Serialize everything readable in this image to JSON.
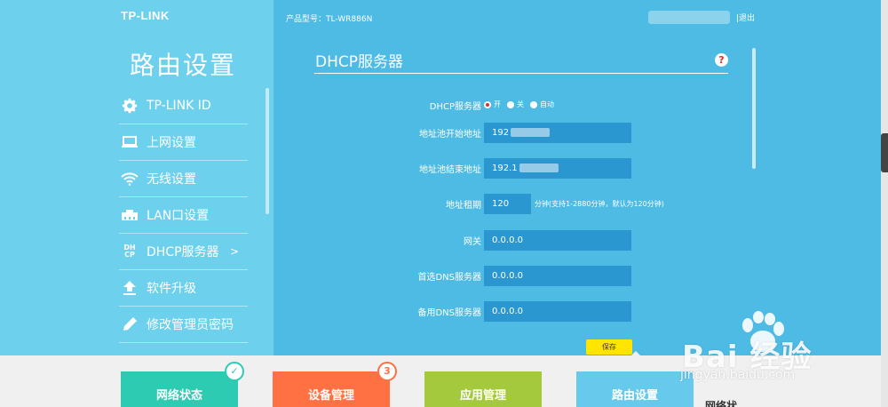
{
  "brand": {
    "logo": "TP-LINK"
  },
  "header": {
    "model_label": "产品型号：TL-WR886N",
    "logout": "|退出"
  },
  "sidebar": {
    "title": "路由设置",
    "items": [
      {
        "label": "TP-LINK ID",
        "icon": "gear-icon"
      },
      {
        "label": "上网设置",
        "icon": "laptop-icon"
      },
      {
        "label": "无线设置",
        "icon": "wifi-icon"
      },
      {
        "label": "LAN口设置",
        "icon": "lan-icon"
      },
      {
        "label": "DHCP服务器",
        "icon": "dhcp-icon",
        "arrow": ">",
        "active": true,
        "icon_text": "DH\nCP"
      },
      {
        "label": "软件升级",
        "icon": "upload-icon"
      },
      {
        "label": "修改管理员密码",
        "icon": "pencil-icon"
      }
    ]
  },
  "main": {
    "section_title": "DHCP服务器",
    "help": "?",
    "form": {
      "dhcp_label": "DHCP服务器",
      "dhcp_options": [
        "开",
        "关",
        "自动"
      ],
      "dhcp_selected": "开",
      "start_label": "地址池开始地址",
      "start_value": "192",
      "end_label": "地址池结束地址",
      "end_value": "192.1",
      "lease_label": "地址租期",
      "lease_value": "120",
      "lease_hint": "分钟(支持1-2880分钟，默认为120分钟)",
      "gateway_label": "网关",
      "gateway_value": "0.0.0.0",
      "dns1_label": "首选DNS服务器",
      "dns1_value": "0.0.0.0",
      "dns2_label": "备用DNS服务器",
      "dns2_value": "0.0.0.0"
    },
    "save_label": "保存"
  },
  "bottom_tabs": [
    {
      "label": "网络状态",
      "color": "#2ecbb3"
    },
    {
      "label": "设备管理",
      "color": "#ff7043",
      "badge": "3"
    },
    {
      "label": "应用管理",
      "color": "#a5c93d"
    },
    {
      "label": "路由设置",
      "color": "#67c9ec"
    }
  ],
  "bottom_extra": "网络状",
  "watermark": {
    "text": "Bai 经验",
    "url": "jingyan.baidu.com"
  },
  "colors": {
    "sidebar_bg": "#6dd0ec",
    "main_bg": "#4dbbe3",
    "input_bg": "#2b97d1",
    "save_bg": "#ffe500"
  }
}
